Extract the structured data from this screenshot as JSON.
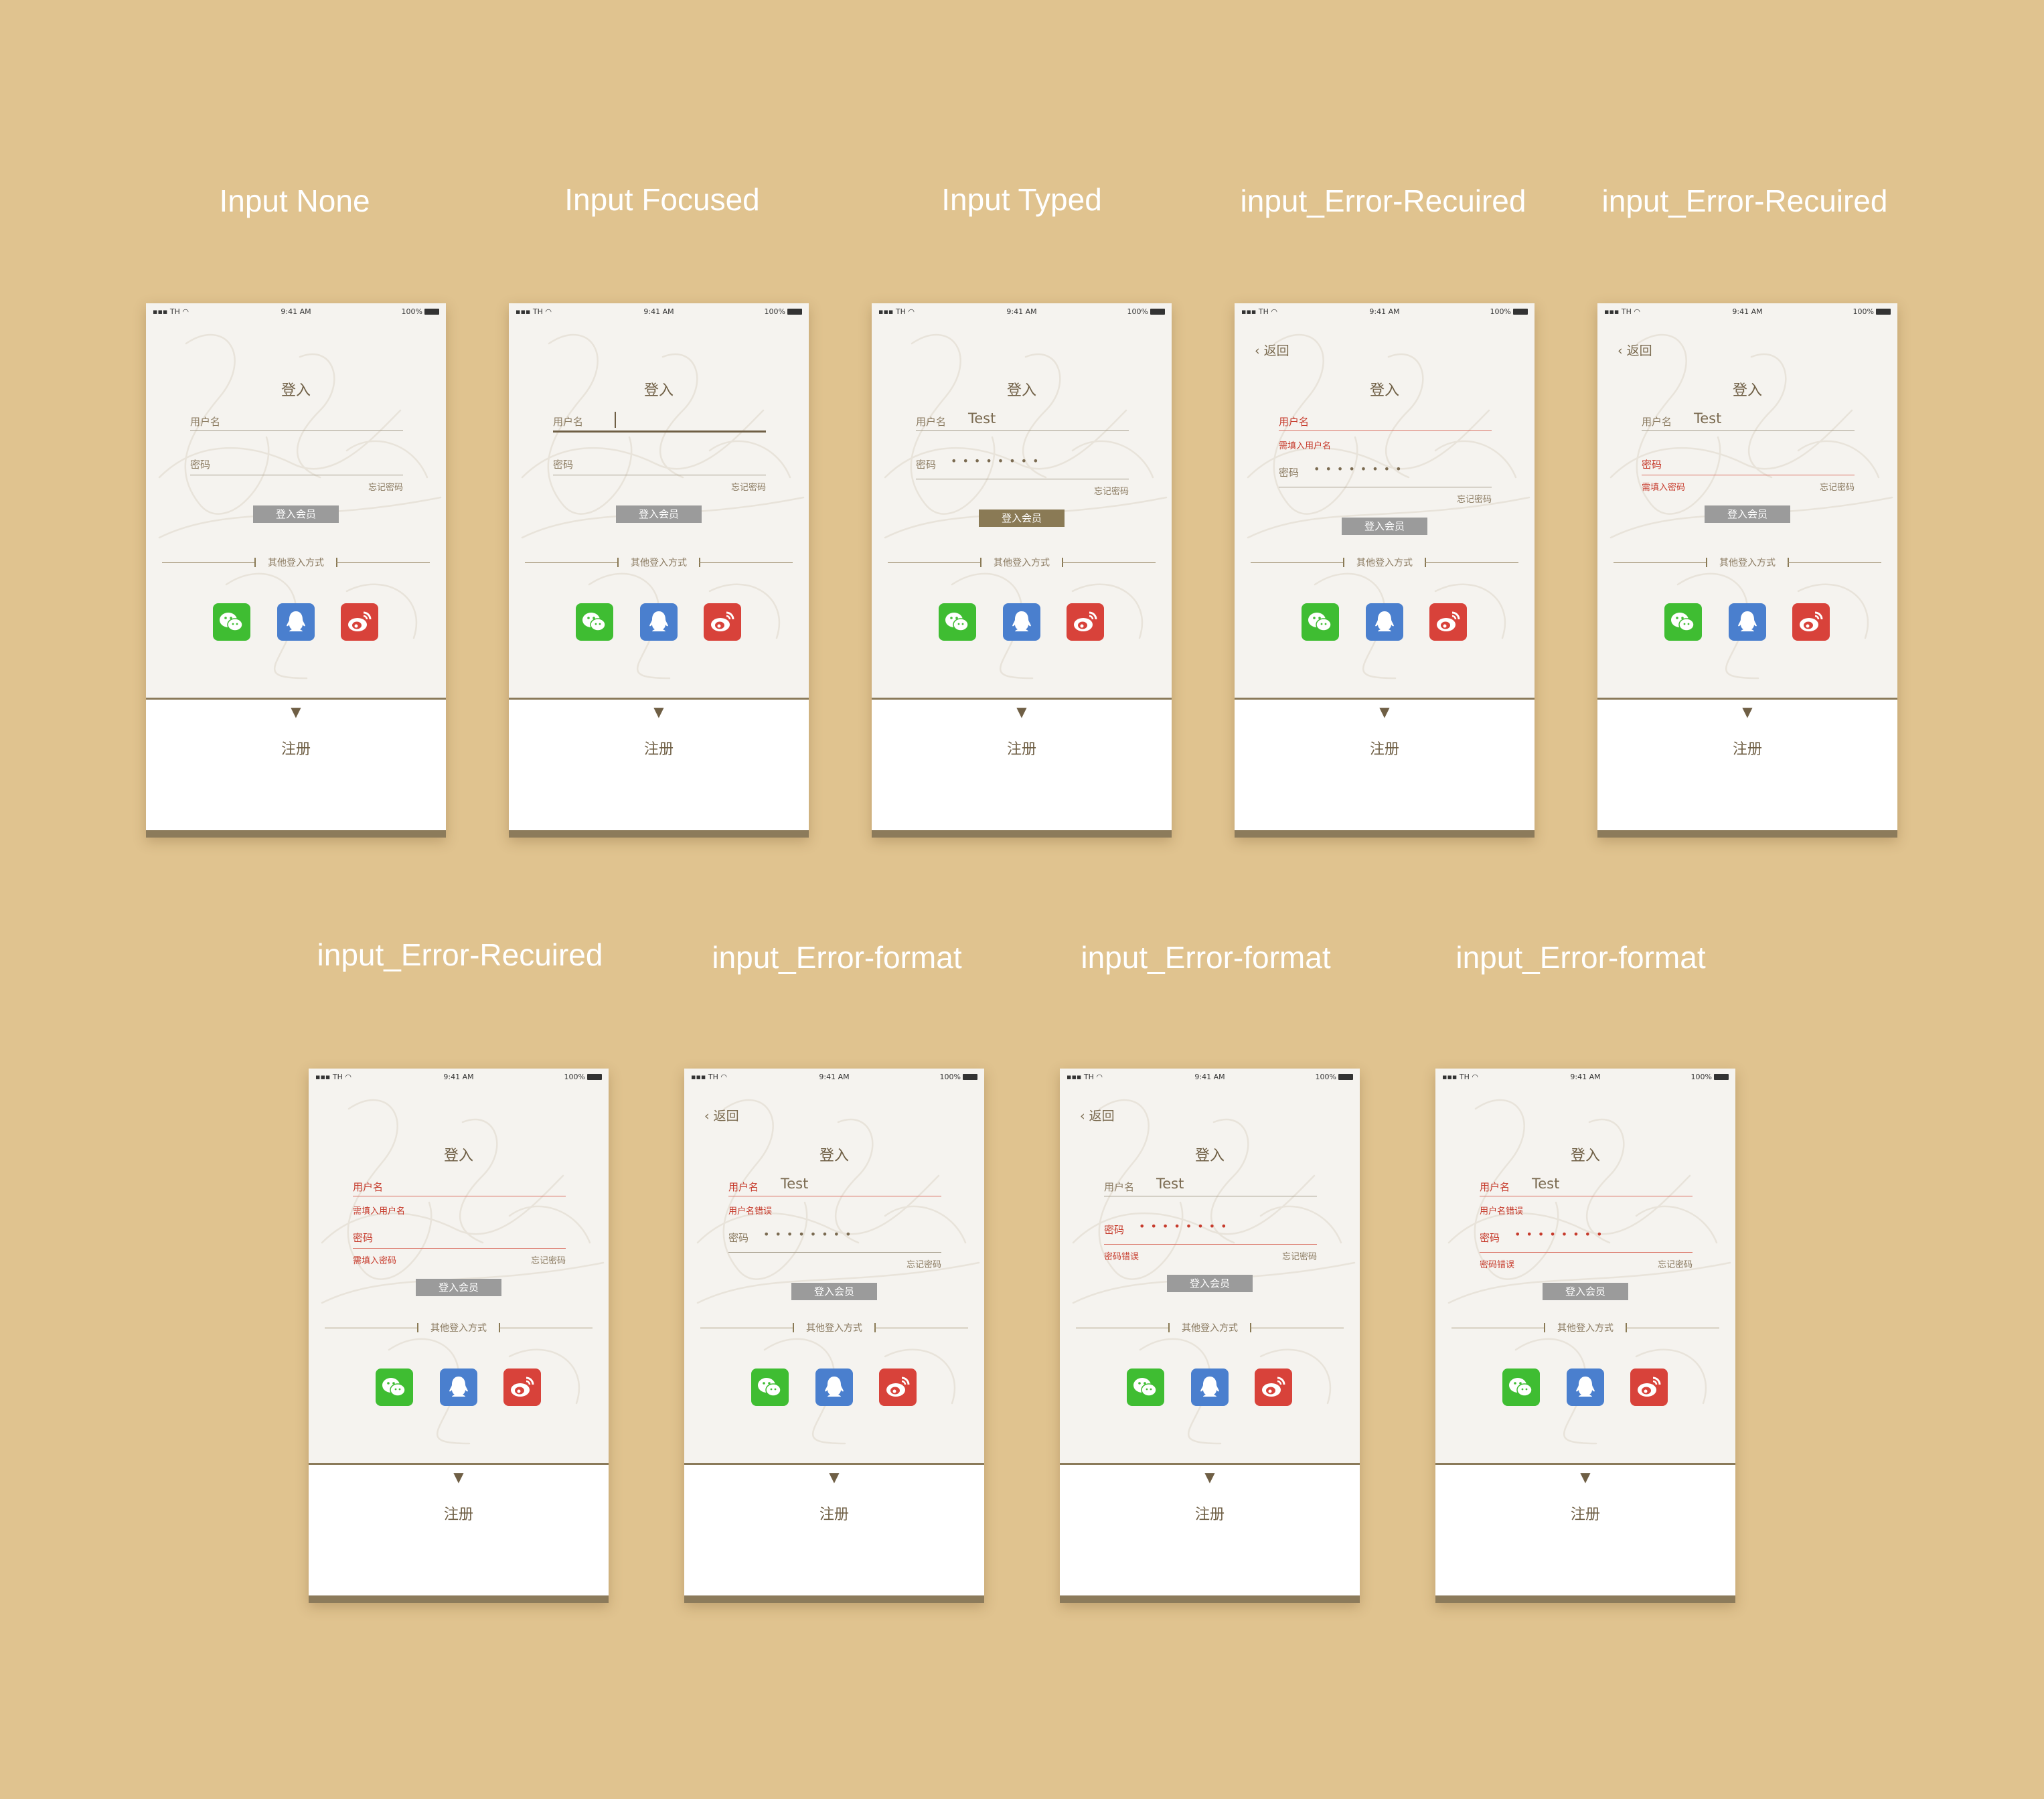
{
  "status_bar": {
    "carrier": "TH",
    "time": "9:41 AM",
    "battery": "100%"
  },
  "common": {
    "back_label": "返回",
    "login_title": "登入",
    "username_label": "用户名",
    "password_label": "密码",
    "forgot_label": "忘记密码",
    "login_button_label": "登入会员",
    "other_login_label": "其他登入方式",
    "register_label": "注册",
    "expand_arrow": "▼",
    "password_dots": "••••••••",
    "typed_username": "Test"
  },
  "colors": {
    "background": "#e0c38f",
    "accent_brown": "#8a7a55",
    "error_red": "#c63a2b",
    "wechat": "#3fbd32",
    "qq": "#4a7fce",
    "weibo": "#d8423a"
  },
  "states": [
    {
      "title": "Input None",
      "show_back": false,
      "focused": false,
      "username_value": "",
      "password_filled": false,
      "username_error": "",
      "password_error": "",
      "username_label_error": false,
      "password_label_error": false,
      "button_active": false
    },
    {
      "title": "Input Focused",
      "show_back": false,
      "focused": true,
      "username_value": "",
      "password_filled": false,
      "username_error": "",
      "password_error": "",
      "username_label_error": false,
      "password_label_error": false,
      "button_active": false
    },
    {
      "title": "Input Typed",
      "show_back": false,
      "focused": false,
      "username_value": "Test",
      "password_filled": true,
      "username_error": "",
      "password_error": "",
      "username_label_error": false,
      "password_label_error": false,
      "button_active": true
    },
    {
      "title": "input_Error-Recuired",
      "show_back": true,
      "focused": false,
      "username_value": "",
      "password_filled": true,
      "username_error": "需填入用户名",
      "password_error": "",
      "username_label_error": true,
      "password_label_error": false,
      "button_active": false
    },
    {
      "title": "input_Error-Recuired",
      "show_back": true,
      "focused": false,
      "username_value": "Test",
      "password_filled": false,
      "username_error": "",
      "password_error": "需填入密码",
      "username_label_error": false,
      "password_label_error": true,
      "button_active": false
    },
    {
      "title": "input_Error-Recuired",
      "show_back": false,
      "focused": false,
      "username_value": "",
      "password_filled": false,
      "username_error": "需填入用户名",
      "password_error": "需填入密码",
      "username_label_error": true,
      "password_label_error": true,
      "button_active": false
    },
    {
      "title": "input_Error-format",
      "show_back": true,
      "focused": false,
      "username_value": "Test",
      "password_filled": true,
      "username_error": "用户名错误",
      "password_error": "",
      "username_label_error": true,
      "password_label_error": false,
      "button_active": false
    },
    {
      "title": "input_Error-format",
      "show_back": true,
      "focused": false,
      "username_value": "Test",
      "password_filled": true,
      "username_error": "",
      "password_error": "密码错误",
      "username_label_error": false,
      "password_label_error": true,
      "button_active": false
    },
    {
      "title": "input_Error-format",
      "show_back": false,
      "focused": false,
      "username_value": "Test",
      "password_filled": true,
      "username_error": "用户名错误",
      "password_error": "密码错误",
      "username_label_error": true,
      "password_label_error": true,
      "button_active": false
    }
  ]
}
